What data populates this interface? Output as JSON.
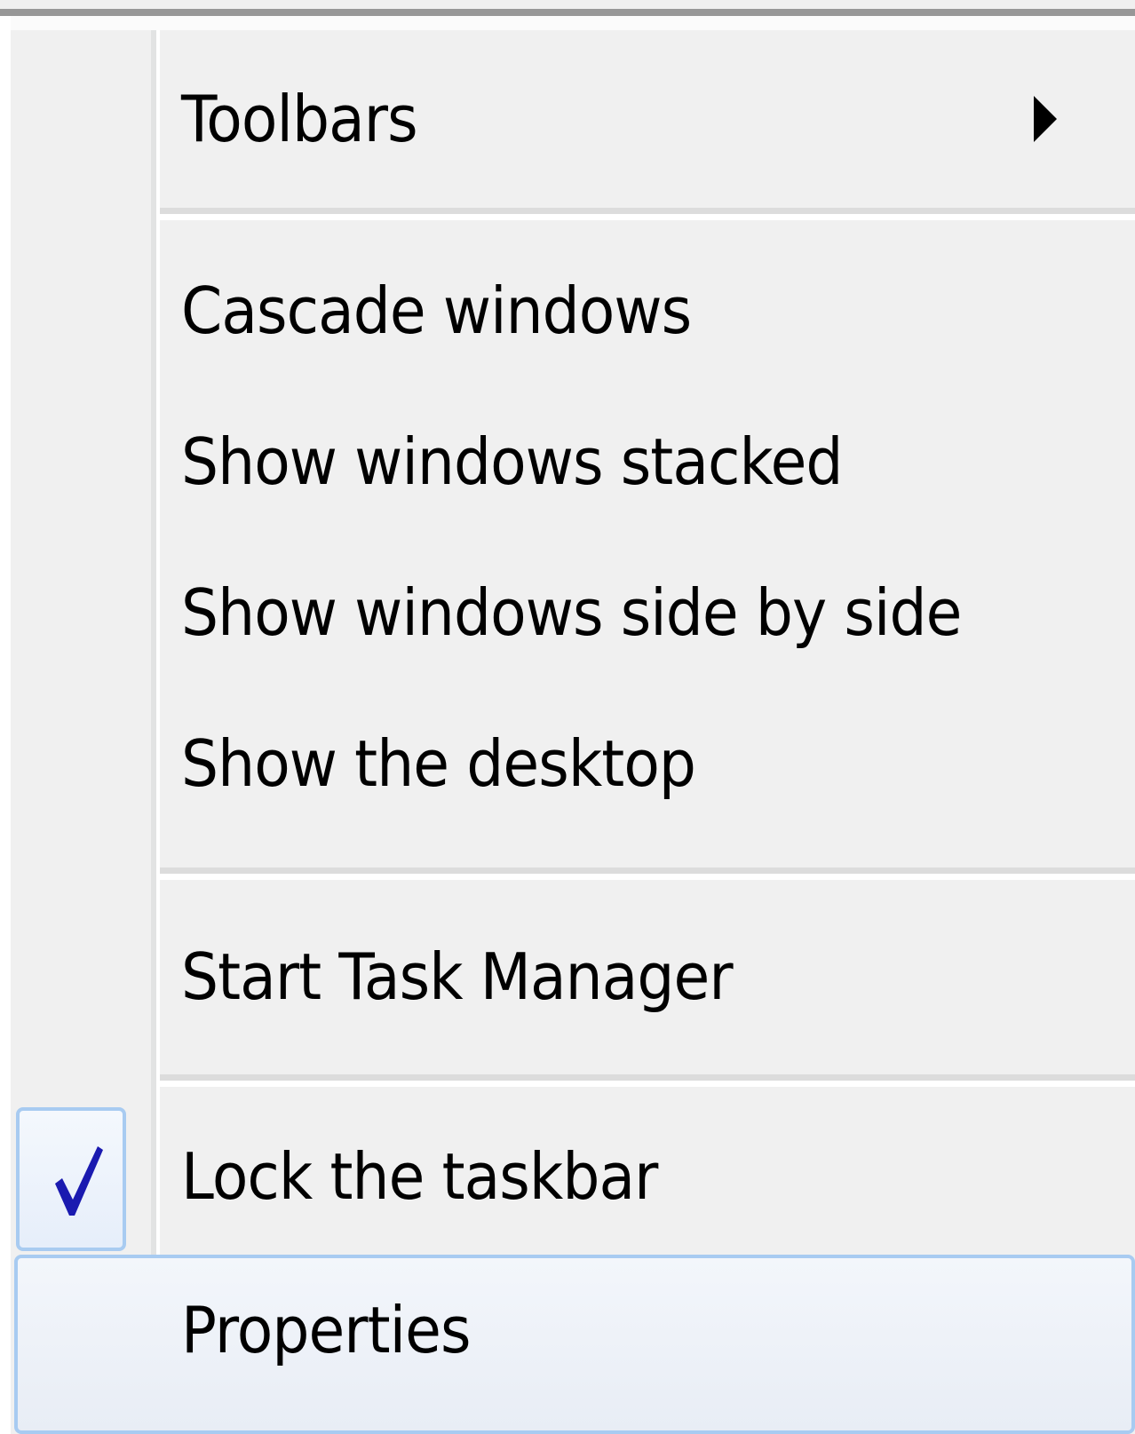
{
  "menu": {
    "items": [
      {
        "label": "Toolbars",
        "has_submenu": true
      },
      {
        "label": "Cascade windows"
      },
      {
        "label": "Show windows stacked"
      },
      {
        "label": "Show windows side by side"
      },
      {
        "label": "Show the desktop"
      },
      {
        "label": "Start Task Manager"
      },
      {
        "label": "Lock the taskbar",
        "checked": true
      },
      {
        "label": "Properties",
        "highlighted": true
      }
    ]
  },
  "icons": {
    "submenu": "chevron-right-icon",
    "check": "checkmark-icon"
  },
  "colors": {
    "menu_bg": "#f0f0f0",
    "highlight_border": "#a8cbf1",
    "check_color": "#1a1ab0",
    "text": "#000000"
  }
}
